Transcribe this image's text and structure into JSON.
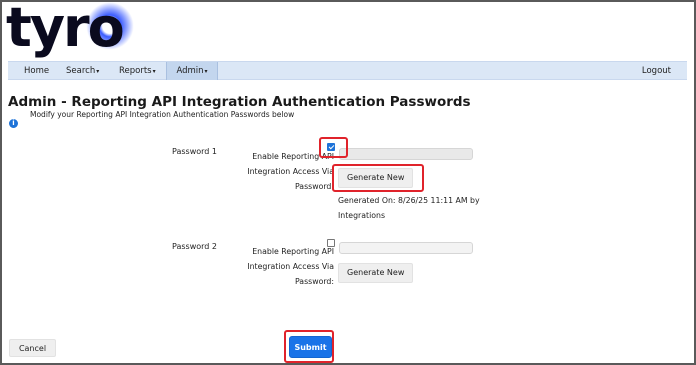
{
  "brand": {
    "logo_text": "tyro"
  },
  "nav": {
    "home": "Home",
    "search": "Search",
    "reports": "Reports",
    "admin": "Admin",
    "logout": "Logout",
    "caret": "▾"
  },
  "page": {
    "title": "Admin - Reporting API Integration Authentication Passwords",
    "subtitle": "Modify your Reporting API Integration Authentication Passwords below"
  },
  "passwords": [
    {
      "label": "Password 1",
      "enable_label": "Enable Reporting API Integration Access Via Password:",
      "enabled": true,
      "generate_label": "Generate New",
      "generated_text": "Generated On: 8/26/25 11:11 AM by Integrations"
    },
    {
      "label": "Password 2",
      "enable_label": "Enable Reporting API Integration Access Via Password:",
      "enabled": false,
      "generate_label": "Generate New",
      "generated_text": ""
    }
  ],
  "actions": {
    "cancel": "Cancel",
    "submit": "Submit"
  },
  "colors": {
    "accent": "#1a73e8",
    "highlight": "#e0232b",
    "nav_bg": "#dbe7f6"
  }
}
